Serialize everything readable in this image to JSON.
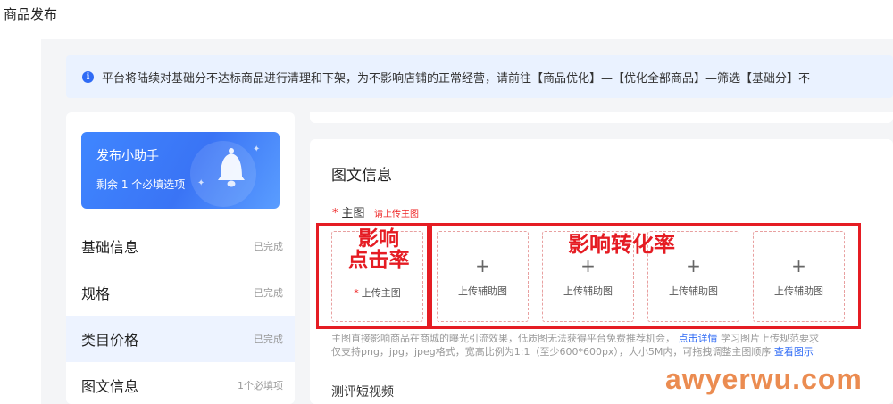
{
  "page": {
    "title": "商品发布"
  },
  "notice": {
    "icon": "info-icon",
    "text": "平台将陆续对基础分不达标商品进行清理和下架，为不影响店铺的正常经营，请前往【商品优化】—【优化全部商品】—筛选【基础分】不"
  },
  "helper": {
    "title": "发布小助手",
    "subtitle": "剩余 1 个必填选项",
    "icon": "bell-icon"
  },
  "nav": [
    {
      "label": "基础信息",
      "status": "已完成"
    },
    {
      "label": "规格",
      "status": "已完成"
    },
    {
      "label": "类目价格",
      "status": "已完成"
    },
    {
      "label": "图文信息",
      "status": "1个必填项"
    }
  ],
  "section": {
    "title": "图文信息",
    "main_image_label": "主图",
    "main_image_star": "*",
    "main_image_warning": "请上传主图",
    "upload_plus": "+",
    "upload_main": "上传主图",
    "upload_aux": "上传辅助图",
    "hint_line1": "主图直接影响商品在商城的曝光引流效果，低质图无法获得平台免费推荐机会，",
    "hint_link1": "点击详情",
    "hint_line1_tail": "学习图片上传规范要求",
    "hint_line2": "仅支持png，jpg，jpeg格式，宽高比例为1:1（至少600*600px），大小5M内，可拖拽调整主图顺序",
    "hint_link2": "查看图示",
    "video_title": "测评短视频"
  },
  "annotations": {
    "left": "影响\n点击率",
    "right": "影响转化率",
    "color": "#e51c23"
  },
  "watermark": "awyerwu.com"
}
